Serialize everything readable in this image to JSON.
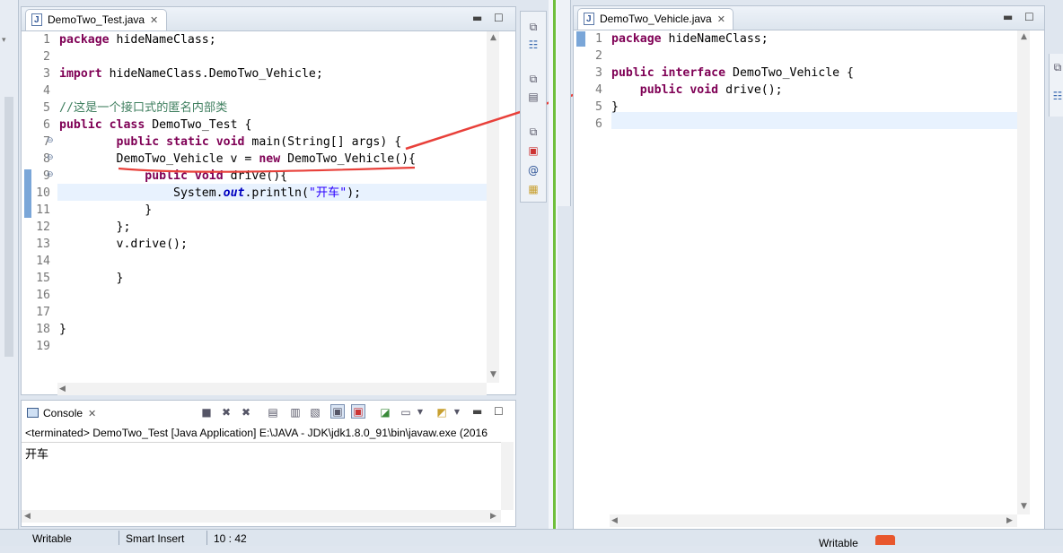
{
  "left_editor": {
    "tab_title": "DemoTwo_Test.java",
    "line_numbers": [
      "1",
      "2",
      "3",
      "4",
      "5",
      "6",
      "7",
      "8",
      "9",
      "10",
      "11",
      "12",
      "13",
      "14",
      "15",
      "16",
      "17",
      "18",
      "19"
    ],
    "lines": [
      [
        [
          "kw",
          "package"
        ],
        [
          "p",
          " hideNameClass;"
        ]
      ],
      [],
      [
        [
          "kw",
          "import"
        ],
        [
          "p",
          " hideNameClass.DemoTwo_Vehicle;"
        ]
      ],
      [],
      [
        [
          "cm",
          "//这是一个接口式的匿名内部类"
        ]
      ],
      [
        [
          "kw",
          "public"
        ],
        [
          "p",
          " "
        ],
        [
          "kw",
          "class"
        ],
        [
          "p",
          " DemoTwo_Test {"
        ]
      ],
      [
        [
          "p",
          "        "
        ],
        [
          "kw",
          "public"
        ],
        [
          "p",
          " "
        ],
        [
          "kw",
          "static"
        ],
        [
          "p",
          " "
        ],
        [
          "kw",
          "void"
        ],
        [
          "p",
          " main(String[] args) {"
        ]
      ],
      [
        [
          "p",
          "        DemoTwo_Vehicle v = "
        ],
        [
          "kw",
          "new"
        ],
        [
          "p",
          " DemoTwo_Vehicle(){"
        ]
      ],
      [
        [
          "p",
          "            "
        ],
        [
          "kw",
          "public"
        ],
        [
          "p",
          " "
        ],
        [
          "kw",
          "void"
        ],
        [
          "p",
          " drive(){"
        ]
      ],
      [
        [
          "p",
          "                System."
        ],
        [
          "fld",
          "out"
        ],
        [
          "p",
          ".println("
        ],
        [
          "st",
          "\"开车\""
        ],
        [
          "p",
          ");"
        ]
      ],
      [
        [
          "p",
          "            }"
        ]
      ],
      [
        [
          "p",
          "        };"
        ]
      ],
      [
        [
          "p",
          "        v.drive();"
        ]
      ],
      [],
      [
        [
          "p",
          "        }"
        ]
      ],
      [],
      [],
      [
        [
          "p",
          "}"
        ]
      ],
      []
    ]
  },
  "right_editor": {
    "tab_title": "DemoTwo_Vehicle.java",
    "line_numbers": [
      "1",
      "2",
      "3",
      "4",
      "5",
      "6"
    ],
    "lines": [
      [
        [
          "kw",
          "package"
        ],
        [
          "p",
          " hideNameClass;"
        ]
      ],
      [],
      [
        [
          "kw",
          "public"
        ],
        [
          "p",
          " "
        ],
        [
          "kw",
          "interface"
        ],
        [
          "p",
          " DemoTwo_Vehicle {"
        ]
      ],
      [
        [
          "p",
          "    "
        ],
        [
          "kw",
          "public"
        ],
        [
          "p",
          " "
        ],
        [
          "kw",
          "void"
        ],
        [
          "p",
          " drive();"
        ]
      ],
      [
        [
          "p",
          "}"
        ]
      ],
      []
    ]
  },
  "console": {
    "tab_title": "Console",
    "status_line": "<terminated> DemoTwo_Test [Java Application] E:\\JAVA - JDK\\jdk1.8.0_91\\bin\\javaw.exe (2016",
    "output": "开车"
  },
  "status_bar": {
    "writable": "Writable",
    "insert_mode": "Smart Insert",
    "position": "10 : 42",
    "right_writable": "Writable"
  },
  "colors": {
    "keyword": "#7f0055",
    "comment": "#3f7f5f",
    "string": "#2a00ff",
    "field": "#0000c0",
    "current_line": "#e8f2fe",
    "annotation_arrow": "#e8403a",
    "divider_green": "#6fbf3c"
  }
}
